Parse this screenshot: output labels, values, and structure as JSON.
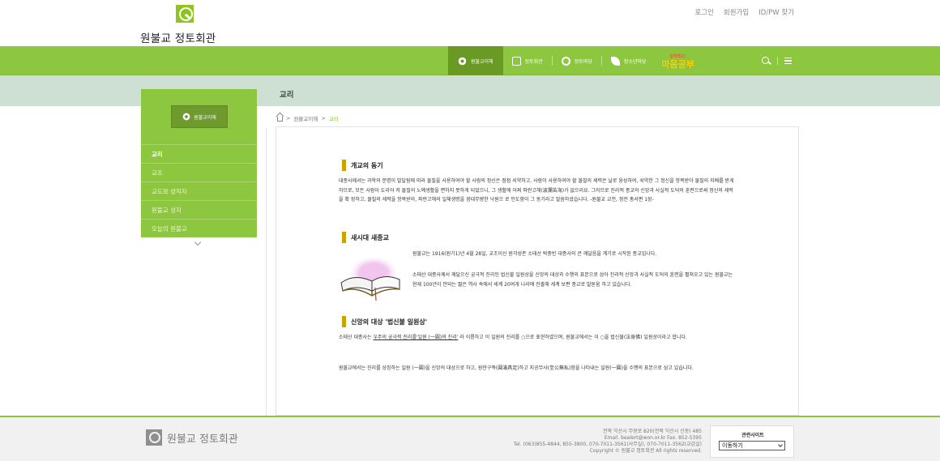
{
  "header": {
    "logo_text": "원불교 정토회관",
    "util_links": [
      "로그인",
      "회원가입",
      "ID/PW 찾기"
    ]
  },
  "gnb": {
    "items": [
      {
        "label": "원불교이해",
        "icon": "flower-icon",
        "active": true
      },
      {
        "label": "정토회관",
        "icon": "house-icon",
        "active": false
      },
      {
        "label": "정토마당",
        "icon": "ring-icon",
        "active": false
      },
      {
        "label": "청소년마당",
        "icon": "leaf-icon",
        "active": false
      }
    ],
    "special": {
      "small": "함께해요!",
      "big": "마음공부"
    },
    "colors": {
      "bar": "#8dc63f",
      "active": "#6a9a23"
    }
  },
  "page": {
    "title": "교리"
  },
  "breadcrumb": {
    "items": [
      "원불교이해",
      "교리"
    ]
  },
  "lnb": {
    "badge_label": "원불교이해",
    "items": [
      {
        "label": "교리",
        "on": true
      },
      {
        "label": "교조",
        "on": false
      },
      {
        "label": "교도와 성직자",
        "on": false
      },
      {
        "label": "원불교 성지",
        "on": false
      },
      {
        "label": "오늘의 원불교",
        "on": false
      }
    ]
  },
  "content": {
    "sections": [
      {
        "heading": "개교의 동기",
        "paragraphs": [
          "대종사께서는 과학의 문명이 발달됨에 따라 물질을 사용하여야 할 사람의 정신은 점점 쇠약하고, 사람이 사용하여야 할 물질의 세력은 날로 융성하여, 쇠약한 그 정신을 항복받아 물질의 지배를 받게 하므로, 모든 사람이 도리어 저 물질의 노예생활을 면하지 못하게 되었으니, 그 생활에 어찌 파란고해(波瀾苦海)가 없으리요. 그러므로 진리적 종교의 신앙과 사실적 도덕의 훈련으로써 정신의 세력을 확 장하고, 물질의 세력을 항복받아, 파란고해의 일체생령을 광대무량한 낙원으 로 인도함이 그 동기라고 말씀하셨습니다. -원불교 교전, 정전 총서편 1장-"
        ]
      },
      {
        "heading": "새시대 새종교",
        "paragraphs": [
          "원불교는 1916(원기1)년 4월 28일, 교조이신 원각성존 소태산 박중빈 대종사의 큰 깨달음을 계기로 시작된 종교입니다.",
          "소태산 대종사께서 깨달으신 궁극적 진리인 법신불 일원상을 신앙의 대상과 수행의 표본으로 삼아 진리적 신앙과 사실적 도덕의 훈련을 펼쳐오고 있는 원불교는 현재 100년이 안되는 짧은 역사 속에서 세계 20여개 나라에 진출해 세계 보편 종교로 발돋움 하고 있습니다."
        ]
      },
      {
        "heading": "신앙의 대상 '법신불 일원상'",
        "p1_before": "소태산 대종사는 ",
        "p1_link": "우주의 궁극적 진리를'일원 (一圓)의 진리'",
        "p1_after": " 라 이름하고 이 일원의 진리를 ○으로 표현하였으며, 원불교에서는 이 ○을 법신불(法身佛) 일원상이라고 합니다.",
        "p2": "원불교에서는 진리를 상징하는 일원 (一圓)을 신앙의 대상으로 하고, 원만구족(圓滿具足)하고 지공무사(至公無私)함을 나타내는 일원(一圓)을 수행의 표본으로 삼고 있습니다."
      }
    ]
  },
  "footer": {
    "logo_text": "원불교 정토회관",
    "info_lines": [
      "전북 익산시 무왕로 820(전북 익산시 신동) 485",
      "Email. bealert@won.or.kr Fax. 852-5395",
      "Tel. (063)855-4844, 855-3800, 070-7011-3561(사무실), 070-7011-3562(교감실)",
      "Copyright © 원불교 정토회관 All rights reserved."
    ],
    "related": {
      "label": "관련사이트",
      "selected": "이동하기"
    }
  }
}
